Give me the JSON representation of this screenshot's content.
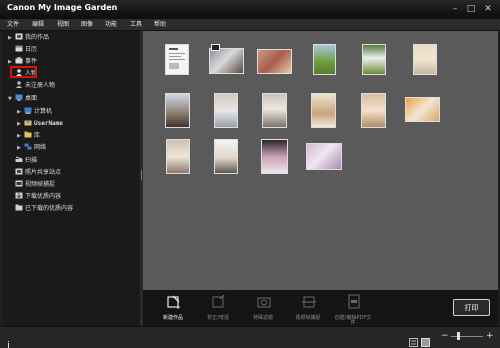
{
  "window": {
    "title": "Canon My Image Garden",
    "controls": {
      "minimize": "–",
      "maximize": "□",
      "close": "✕"
    }
  },
  "menu": [
    "文件",
    "编辑",
    "视图",
    "图像",
    "功能",
    "工具",
    "帮助"
  ],
  "sidebar": {
    "items": [
      {
        "label": "我的作品",
        "arrow": "▶",
        "icon": "works-icon"
      },
      {
        "label": "日历",
        "arrow": "",
        "icon": "calendar-icon"
      },
      {
        "label": "事件",
        "arrow": "▶",
        "icon": "event-icon"
      },
      {
        "label": "人物",
        "arrow": "",
        "icon": "person-icon",
        "selected": true
      },
      {
        "label": "未注册人物",
        "arrow": "",
        "icon": "unregistered-person-icon"
      },
      {
        "label": "桌面",
        "arrow": "▼",
        "icon": "desktop-icon"
      },
      {
        "label": "计算机",
        "arrow": "▶",
        "icon": "computer-icon"
      },
      {
        "label": "UserName",
        "arrow": "▶",
        "icon": "user-folder-icon"
      },
      {
        "label": "库",
        "arrow": "▶",
        "icon": "library-icon"
      },
      {
        "label": "网络",
        "arrow": "▶",
        "icon": "network-icon"
      },
      {
        "label": "扫描",
        "arrow": "",
        "icon": "scan-icon"
      },
      {
        "label": "照片共享站点",
        "arrow": "",
        "icon": "photo-share-icon"
      },
      {
        "label": "视频帧捕捉",
        "arrow": "",
        "icon": "video-frame-icon"
      },
      {
        "label": "下载优质内容",
        "arrow": "",
        "icon": "download-icon"
      },
      {
        "label": "已下载的优质内容",
        "arrow": "",
        "icon": "downloaded-icon"
      }
    ]
  },
  "toolbar": {
    "buttons": [
      {
        "label": "新建作品",
        "icon": "new-work-icon",
        "enabled": true
      },
      {
        "label": "校正/增强",
        "icon": "correct-enhance-icon",
        "enabled": false
      },
      {
        "label": "特殊滤镜",
        "icon": "special-filter-icon",
        "enabled": false
      },
      {
        "label": "视频帧捕捉",
        "icon": "video-capture-icon",
        "enabled": false
      },
      {
        "label": "创建/编辑PDF文件",
        "icon": "pdf-icon",
        "enabled": false
      }
    ],
    "print_label": "打印"
  },
  "statusbar": {
    "left_icon": "info-icon",
    "zoom_minus": "−",
    "zoom_plus": "+"
  },
  "colors": {
    "accent_selection": "#d41414",
    "panel_bg": "#5a5a5a",
    "sidebar_bg": "#1a1a1a"
  }
}
